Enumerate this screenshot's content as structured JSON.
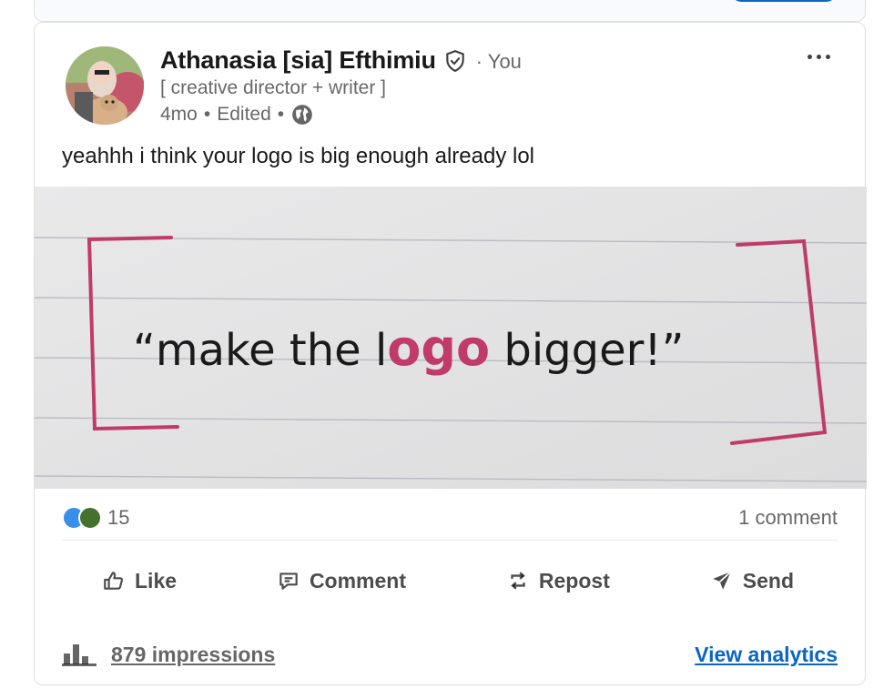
{
  "colors": {
    "brand_blue": "#0a66c2",
    "text": "#191919",
    "muted": "#666666",
    "marker_pink": "#c03a6a"
  },
  "post": {
    "author": {
      "name": "Athanasia [sia] Efthimiu",
      "connection": "You",
      "headline": "[ creative director + writer ]",
      "time": "4mo",
      "edited": "Edited",
      "avatar_icon": "profile-photo",
      "verified_icon": "verified-shield-icon",
      "visibility_icon": "globe-icon"
    },
    "more_icon": "ellipsis-icon",
    "text": "yeahhh i think your logo is big enough already lol",
    "image": {
      "handwriting": {
        "before": "“make the l",
        "highlight": "ogo",
        "after": " bigger!”"
      }
    },
    "social": {
      "reaction_count": "15",
      "reaction_icons": [
        "like-icon",
        "support-icon"
      ],
      "comments": "1 comment"
    },
    "actions": [
      {
        "label": "Like",
        "icon": "thumbs-up-icon"
      },
      {
        "label": "Comment",
        "icon": "comment-icon"
      },
      {
        "label": "Repost",
        "icon": "repost-icon"
      },
      {
        "label": "Send",
        "icon": "send-icon"
      }
    ],
    "analytics": {
      "impressions": "879 impressions",
      "view": "View analytics",
      "icon": "bar-chart-icon"
    }
  }
}
